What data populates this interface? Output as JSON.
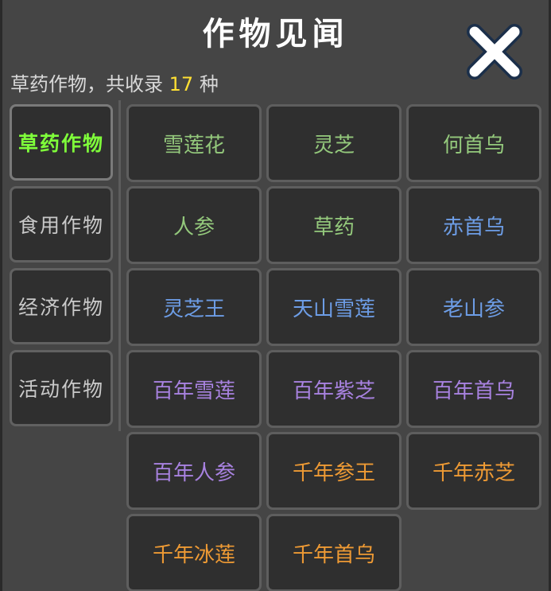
{
  "title": "作物见闻",
  "subtitle": {
    "prefix": "草药作物，共收录",
    "count": "17",
    "suffix": "种"
  },
  "categories": [
    {
      "label": "草药作物",
      "active": true
    },
    {
      "label": "食用作物",
      "active": false
    },
    {
      "label": "经济作物",
      "active": false
    },
    {
      "label": "活动作物",
      "active": false
    }
  ],
  "crops": [
    {
      "name": "雪莲花",
      "rarity": "green"
    },
    {
      "name": "灵芝",
      "rarity": "green"
    },
    {
      "name": "何首乌",
      "rarity": "green"
    },
    {
      "name": "人参",
      "rarity": "green"
    },
    {
      "name": "草药",
      "rarity": "green"
    },
    {
      "name": "赤首乌",
      "rarity": "blue"
    },
    {
      "name": "灵芝王",
      "rarity": "blue"
    },
    {
      "name": "天山雪莲",
      "rarity": "blue"
    },
    {
      "name": "老山参",
      "rarity": "blue"
    },
    {
      "name": "百年雪莲",
      "rarity": "purple"
    },
    {
      "name": "百年紫芝",
      "rarity": "purple"
    },
    {
      "name": "百年首乌",
      "rarity": "purple"
    },
    {
      "name": "百年人参",
      "rarity": "purple"
    },
    {
      "name": "千年参王",
      "rarity": "orange"
    },
    {
      "name": "千年赤芝",
      "rarity": "orange"
    },
    {
      "name": "千年冰莲",
      "rarity": "orange"
    },
    {
      "name": "千年首乌",
      "rarity": "orange"
    }
  ],
  "colors": {
    "active_category": "#7fff3a",
    "count_highlight": "#ffe033",
    "green": "#94c97c",
    "blue": "#6d9de6",
    "purple": "#a882e0",
    "orange": "#ee9a34"
  },
  "icons": {
    "close": "close-icon"
  }
}
